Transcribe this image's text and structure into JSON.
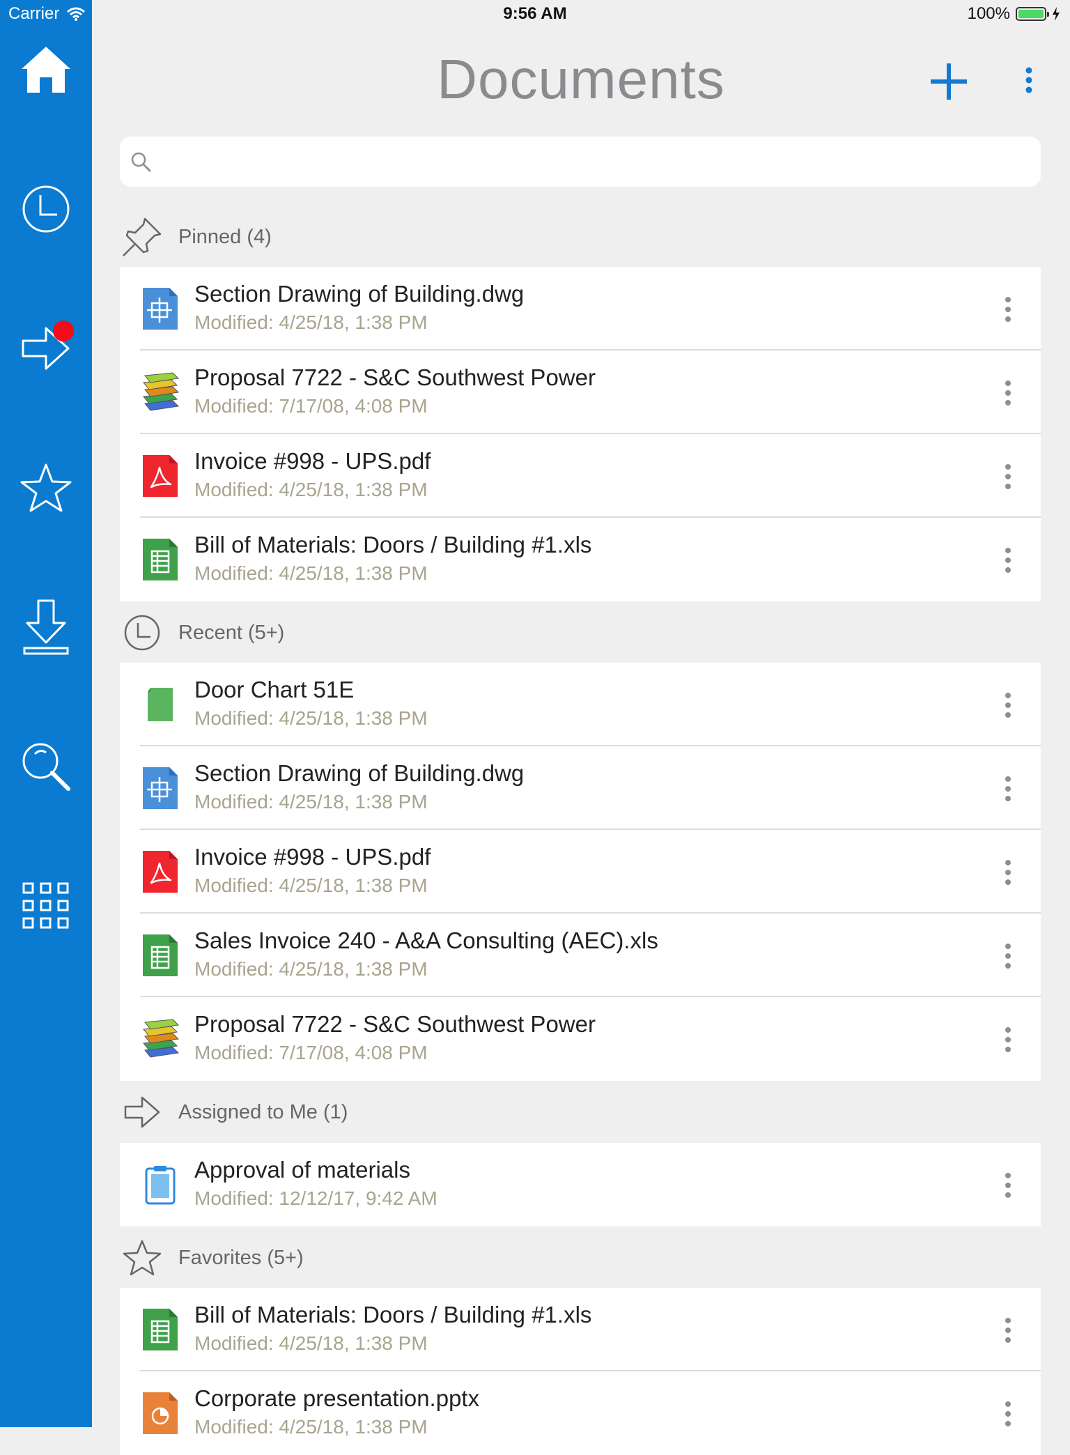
{
  "status_bar": {
    "carrier": "Carrier",
    "time": "9:56 AM",
    "battery": "100%"
  },
  "sidebar": {
    "items": [
      {
        "name": "home",
        "icon": "home-icon"
      },
      {
        "name": "recent",
        "icon": "clock-icon"
      },
      {
        "name": "assigned",
        "icon": "arrow-right-icon"
      },
      {
        "name": "favorites",
        "icon": "star-icon"
      },
      {
        "name": "downloads",
        "icon": "download-icon"
      },
      {
        "name": "search",
        "icon": "magnifier-icon"
      },
      {
        "name": "apps",
        "icon": "grid-icon"
      }
    ],
    "accent_color": "#0a7bd0",
    "badge_color": "#f50a1a"
  },
  "header": {
    "title": "Documents"
  },
  "search": {
    "placeholder": "",
    "value": ""
  },
  "sections": [
    {
      "label": "Pinned (4)",
      "icon": "pin-icon",
      "items": [
        {
          "name": "Section Drawing of Building.dwg",
          "modified": "Modified: 4/25/18, 1:38 PM",
          "icon": "dwg-file-icon"
        },
        {
          "name": "Proposal 7722 - S&C Southwest Power",
          "modified": "Modified: 7/17/08, 4:08 PM",
          "icon": "binder-stack-icon"
        },
        {
          "name": "Invoice #998 - UPS.pdf",
          "modified": "Modified: 4/25/18, 1:38 PM",
          "icon": "pdf-file-icon"
        },
        {
          "name": "Bill of Materials: Doors / Building #1.xls",
          "modified": "Modified: 4/25/18, 1:38 PM",
          "icon": "xls-file-icon"
        }
      ]
    },
    {
      "label": "Recent (5+)",
      "icon": "clock-icon",
      "items": [
        {
          "name": "Door Chart 51E",
          "modified": "Modified: 4/25/18, 1:38 PM",
          "icon": "green-file-icon"
        },
        {
          "name": "Section Drawing of Building.dwg",
          "modified": "Modified: 4/25/18, 1:38 PM",
          "icon": "dwg-file-icon"
        },
        {
          "name": "Invoice #998 - UPS.pdf",
          "modified": "Modified: 4/25/18, 1:38 PM",
          "icon": "pdf-file-icon"
        },
        {
          "name": "Sales Invoice 240 - A&A Consulting (AEC).xls",
          "modified": "Modified: 4/25/18, 1:38 PM",
          "icon": "xls-file-icon"
        },
        {
          "name": "Proposal 7722 - S&C Southwest Power",
          "modified": "Modified: 7/17/08, 4:08 PM",
          "icon": "binder-stack-icon"
        }
      ]
    },
    {
      "label": "Assigned to Me (1)",
      "icon": "arrow-right-icon",
      "items": [
        {
          "name": "Approval of materials",
          "modified": "Modified: 12/12/17, 9:42 AM",
          "icon": "clipboard-icon"
        }
      ]
    },
    {
      "label": "Favorites (5+)",
      "icon": "star-icon",
      "items": [
        {
          "name": "Bill of Materials: Doors / Building #1.xls",
          "modified": "Modified: 4/25/18, 1:38 PM",
          "icon": "xls-file-icon"
        },
        {
          "name": "Corporate presentation.pptx",
          "modified": "Modified: 4/25/18, 1:38 PM",
          "icon": "pptx-file-icon"
        }
      ]
    }
  ]
}
